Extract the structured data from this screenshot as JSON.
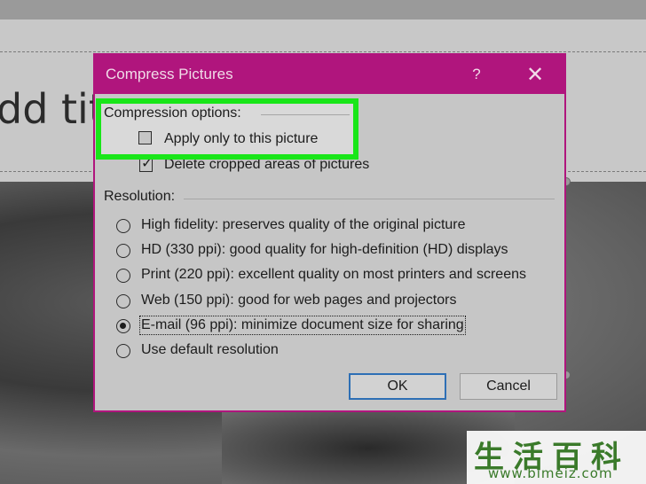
{
  "background": {
    "slide_title_fragment": "dd tit"
  },
  "dialog": {
    "title": "Compress Pictures",
    "help_glyph": "?",
    "close_glyph": "✕",
    "compression_options": {
      "label": "Compression options:",
      "apply_only_label": "Apply only to this picture",
      "apply_only_checked": false,
      "delete_cropped_label": "Delete cropped areas of pictures",
      "delete_cropped_checked": true
    },
    "resolution": {
      "label": "Resolution:",
      "options": [
        {
          "label": "High fidelity: preserves quality of the original picture",
          "selected": false
        },
        {
          "label": "HD (330 ppi): good quality for high-definition (HD) displays",
          "selected": false
        },
        {
          "label": "Print (220 ppi): excellent quality on most printers and screens",
          "selected": false
        },
        {
          "label": "Web (150 ppi): good for web pages and projectors",
          "selected": false
        },
        {
          "label": "E-mail (96 ppi): minimize document size for sharing",
          "selected": true
        },
        {
          "label": "Use default resolution",
          "selected": false
        }
      ]
    },
    "ok_label": "OK",
    "cancel_label": "Cancel"
  },
  "watermark": {
    "chars": "生活百科",
    "url": "www.bimeiz.com"
  },
  "colors": {
    "dialog_accent": "#b0157d",
    "highlight": "#19e619",
    "primary_button_border": "#2e6fb5"
  }
}
